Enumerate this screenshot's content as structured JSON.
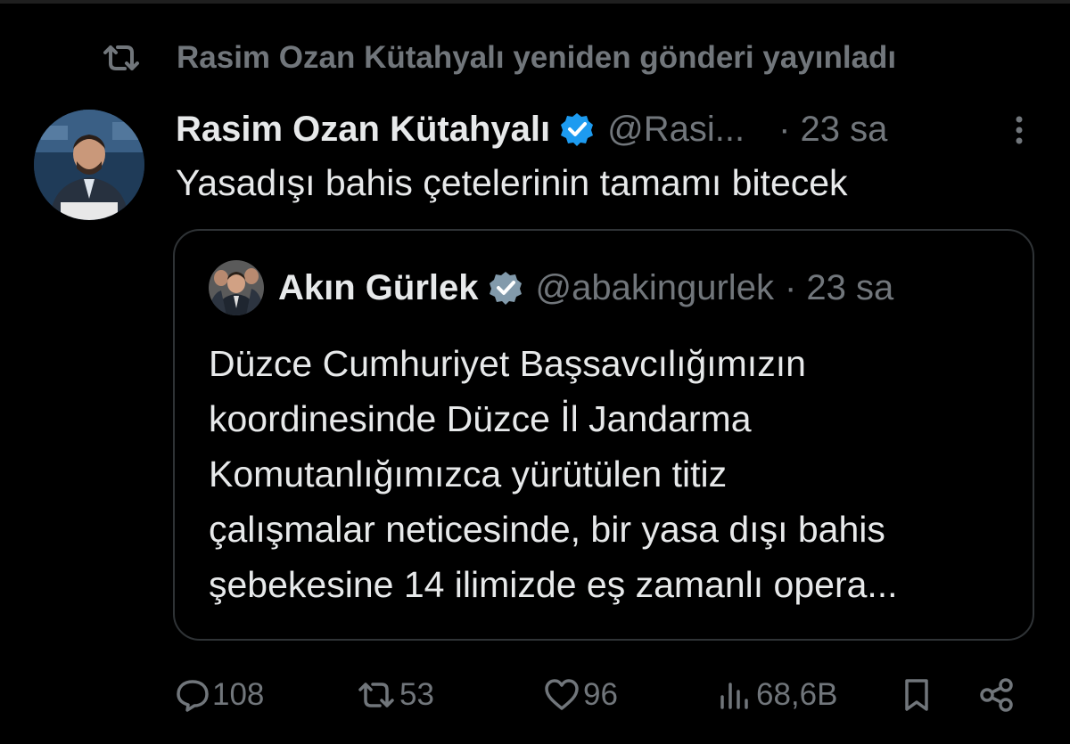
{
  "repost": {
    "label": "Rasim Ozan Kütahyalı yeniden gönderi yayınladı",
    "icon": "repost-icon"
  },
  "tweet": {
    "author_name": "Rasim Ozan Kütahyalı",
    "handle": "@Rasi...",
    "time": "· 23 sa",
    "text": "Yasadışı bahis çetelerinin tamamı bitecek",
    "verified_color": "#1d9bf0",
    "icons": {
      "avatar": "avatar",
      "verified": "verified-badge-icon",
      "more": "more-options-icon"
    }
  },
  "quote": {
    "author_name": "Akın Gürlek",
    "handle": "@abakingurlek",
    "time": "· 23 sa",
    "verified_color": "#829aab",
    "lines": [
      "Düzce Cumhuriyet Başsavcılığımızın",
      "koordinesinde Düzce İl Jandarma",
      "Komutanlığımızca yürütülen titiz",
      "çalışmalar neticesinde, bir yasa dışı bahis",
      "şebekesine 14 ilimizde eş zamanlı opera..."
    ]
  },
  "actions": {
    "replies": "108",
    "reposts": "53",
    "likes": "96",
    "views": "68,6B",
    "icons": [
      "reply-icon",
      "repost-icon",
      "like-icon",
      "views-icon",
      "bookmark-icon",
      "share-icon"
    ]
  },
  "colors": {
    "background": "#000000",
    "text_primary": "#e7e9ea",
    "text_secondary": "#71767b",
    "border": "#2f3336"
  }
}
